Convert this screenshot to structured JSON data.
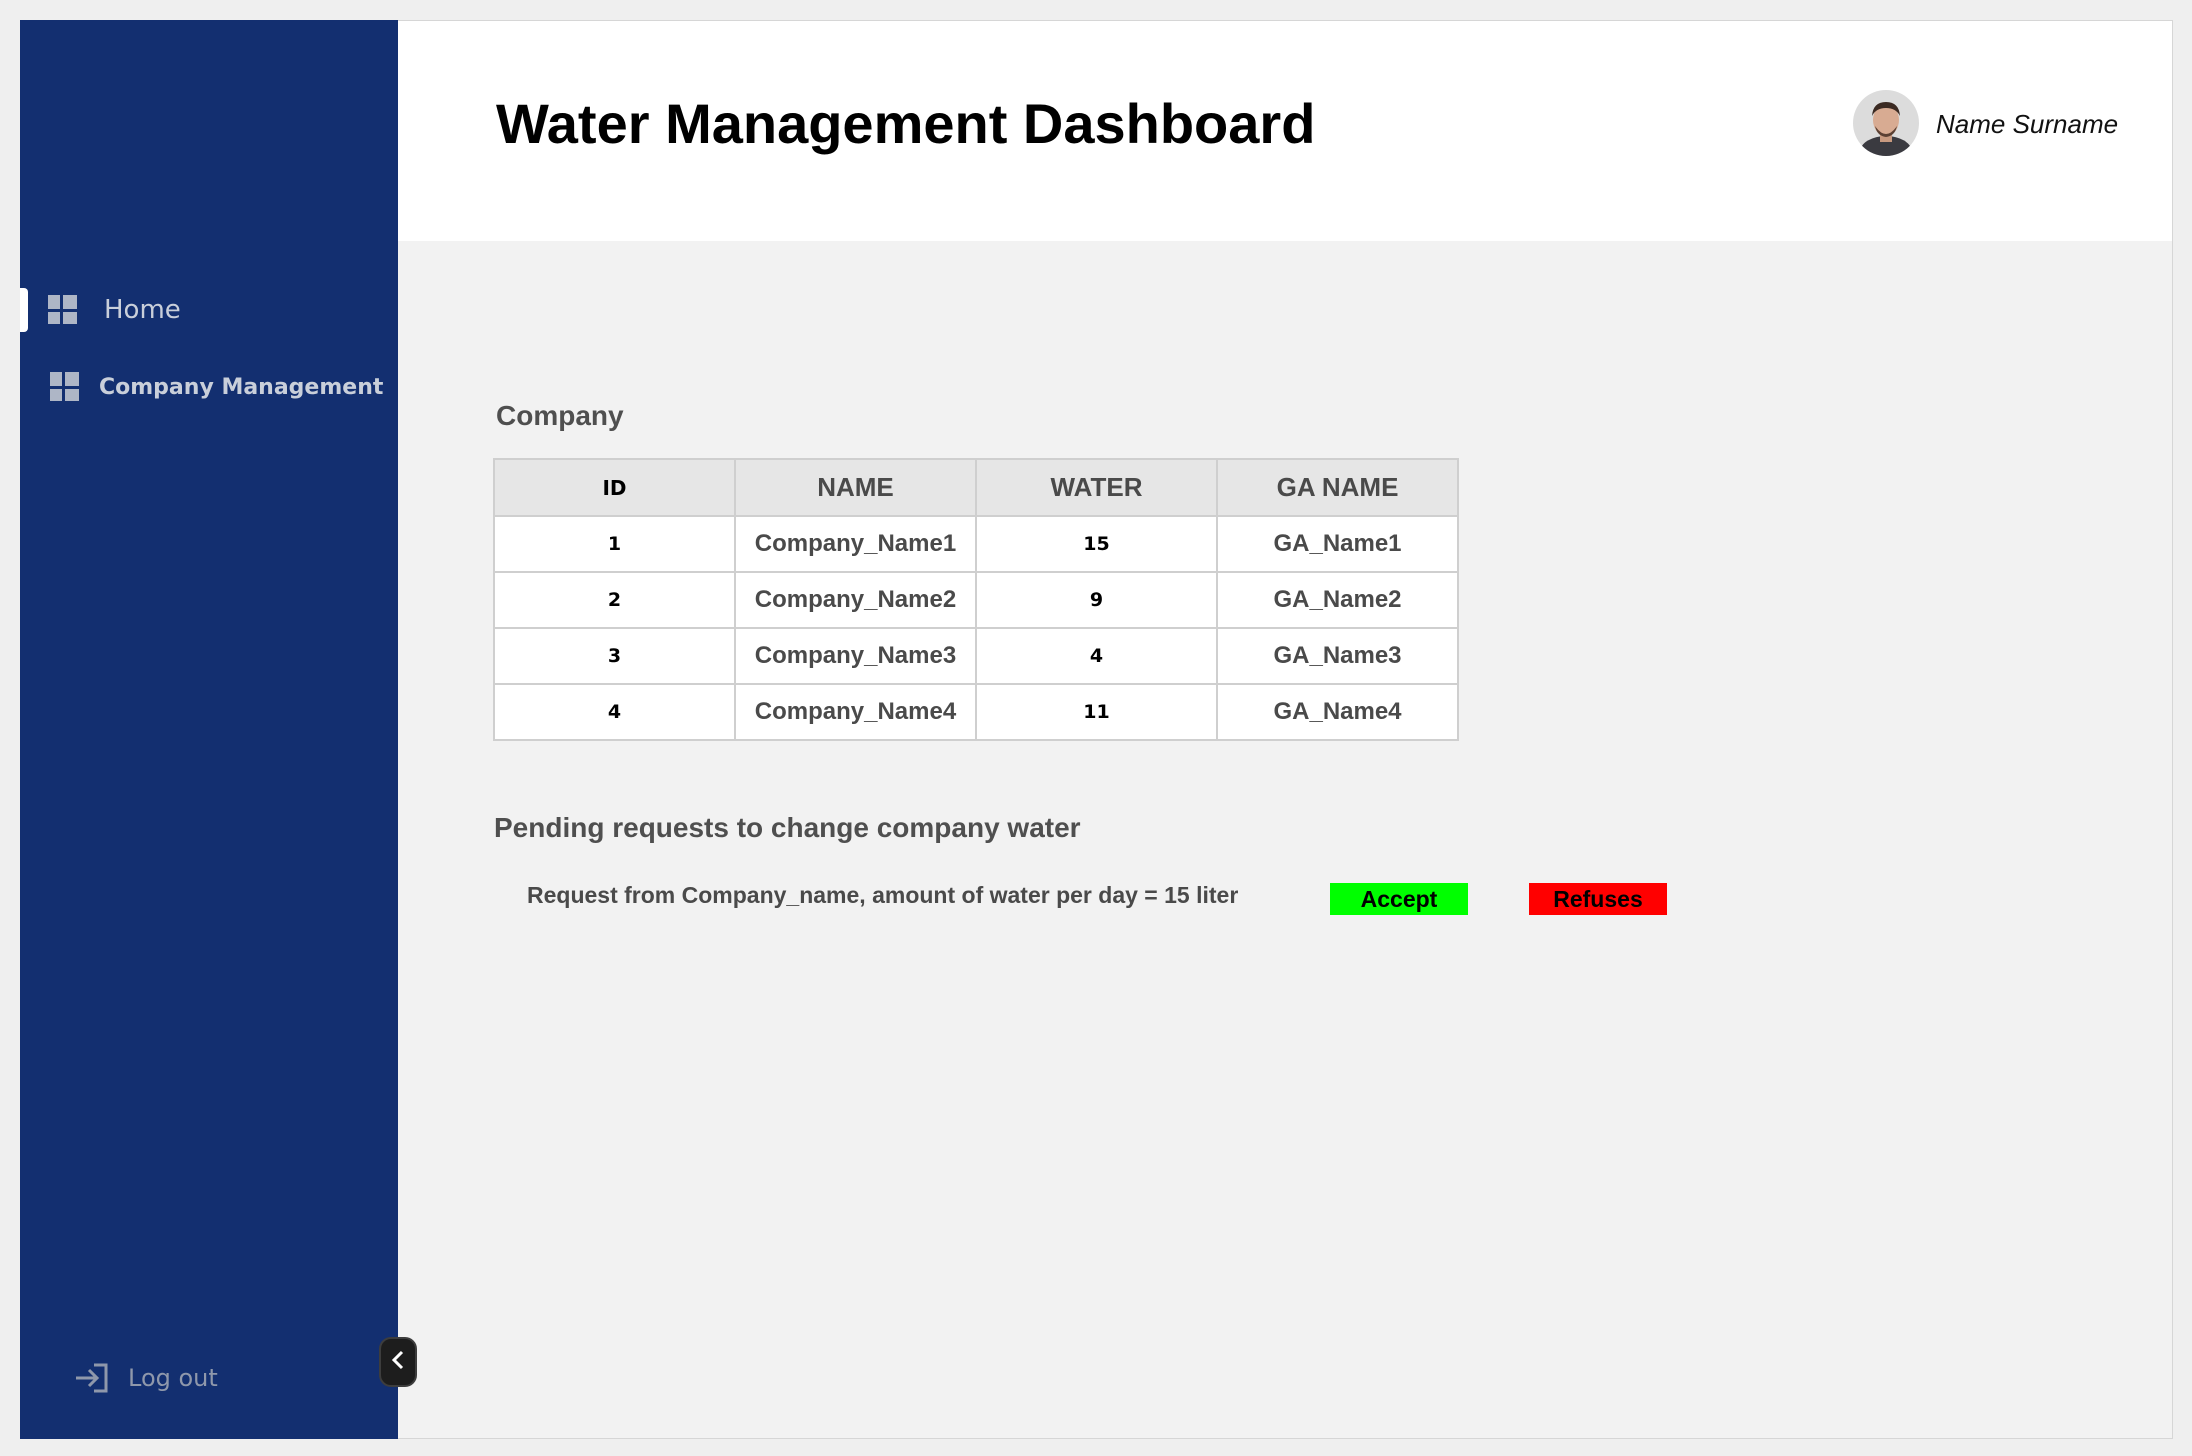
{
  "app": {
    "title": "Water Management Dashboard",
    "user_name": "Name Surname"
  },
  "sidebar": {
    "items": [
      {
        "label": "Home",
        "icon": "dashboard-icon",
        "active": true
      },
      {
        "label": "Company Management",
        "icon": "dashboard-icon",
        "active": false
      }
    ],
    "logout_label": "Log out",
    "collapse_icon": "chevron-left-icon"
  },
  "company_section": {
    "title": "Company",
    "columns": [
      "ID",
      "NAME",
      "WATER",
      "GA NAME"
    ],
    "rows": [
      {
        "id": "1",
        "name": "Company_Name1",
        "water": "15",
        "ga_name": "GA_Name1"
      },
      {
        "id": "2",
        "name": "Company_Name2",
        "water": "9",
        "ga_name": "GA_Name2"
      },
      {
        "id": "3",
        "name": "Company_Name3",
        "water": "4",
        "ga_name": "GA_Name3"
      },
      {
        "id": "4",
        "name": "Company_Name4",
        "water": "11",
        "ga_name": "GA_Name4"
      }
    ]
  },
  "pending_section": {
    "title": "Pending requests to change company water",
    "requests": [
      {
        "text": "Request from Company_name, amount of water per day = 15 liter",
        "accept_label": "Accept",
        "refuse_label": "Refuses"
      }
    ]
  },
  "colors": {
    "sidebar_bg": "#132f70",
    "accept": "#00ff00",
    "refuse": "#ff0000",
    "content_bg": "#f2f2f2"
  }
}
